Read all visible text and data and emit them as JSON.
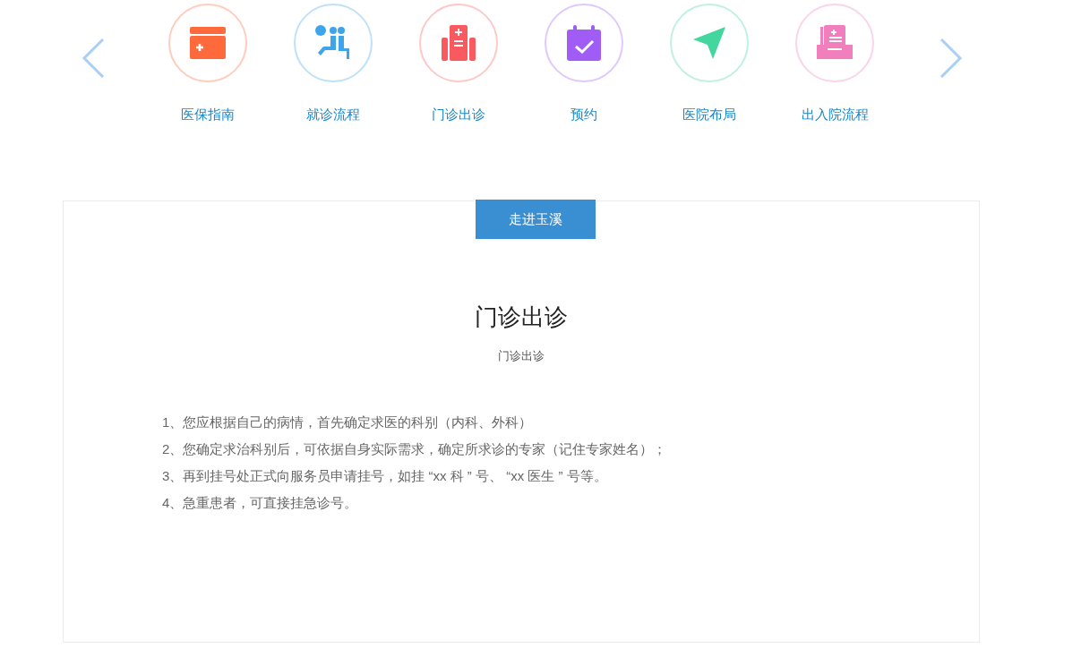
{
  "nav": {
    "items": [
      {
        "label": "医保指南",
        "kind": "card",
        "color": "#ff6a3d"
      },
      {
        "label": "就诊流程",
        "kind": "waiting",
        "color": "#3ea5ea"
      },
      {
        "label": "门诊出诊",
        "kind": "building",
        "color": "#f95a5f"
      },
      {
        "label": "预约",
        "kind": "calendar",
        "color": "#a05cf5"
      },
      {
        "label": "医院布局",
        "kind": "pointer",
        "color": "#43d69e"
      },
      {
        "label": "出入院流程",
        "kind": "tray",
        "color": "#f17fbd"
      }
    ]
  },
  "panel": {
    "tab": "走进玉溪",
    "title": "门诊出诊",
    "subtitle": "门诊出诊",
    "lines": [
      "1、您应根据自己的病情，首先确定求医的科别（内科、外科）",
      "2、您确定求治科别后，可依据自身实际需求，确定所求诊的专家（记住专家姓名）；",
      "3、再到挂号处正式向服务员申请挂号，如挂 “xx 科 ” 号、 “xx 医生 ” 号等。",
      "4、急重患者，可直接挂急诊号。"
    ]
  }
}
